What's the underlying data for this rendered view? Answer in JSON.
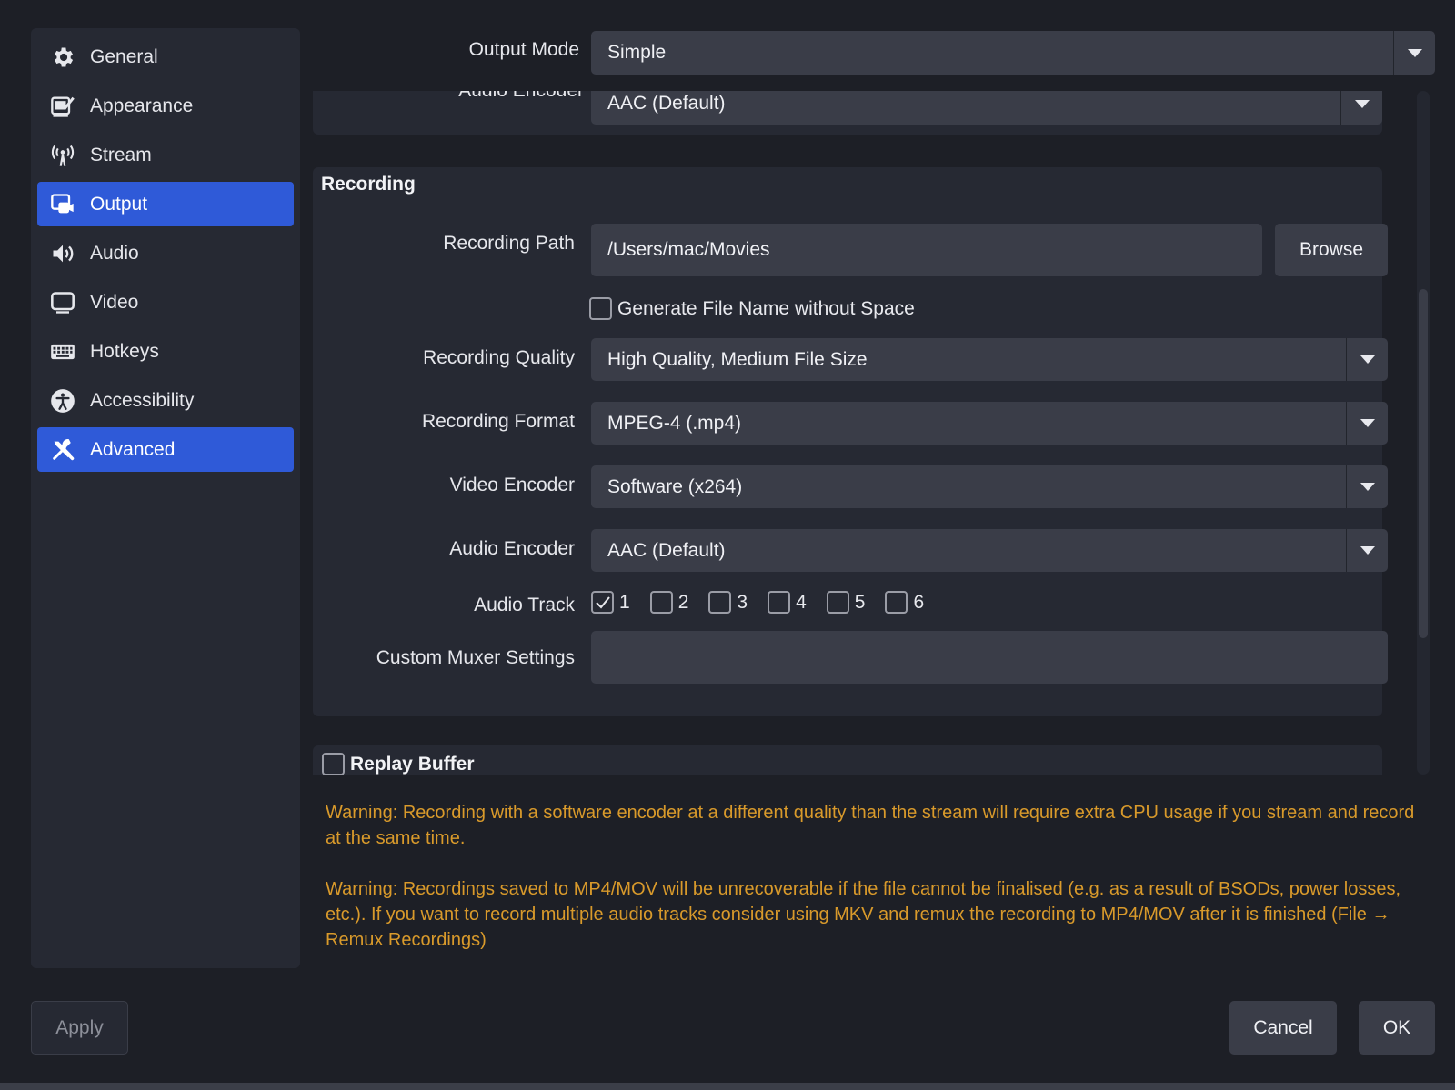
{
  "sidebar": {
    "items": [
      {
        "label": "General",
        "icon": "gear-icon",
        "active": false
      },
      {
        "label": "Appearance",
        "icon": "appearance-icon",
        "active": false
      },
      {
        "label": "Stream",
        "icon": "antenna-icon",
        "active": false
      },
      {
        "label": "Output",
        "icon": "output-icon",
        "active": true
      },
      {
        "label": "Audio",
        "icon": "speaker-icon",
        "active": false
      },
      {
        "label": "Video",
        "icon": "monitor-icon",
        "active": false
      },
      {
        "label": "Hotkeys",
        "icon": "keyboard-icon",
        "active": false
      },
      {
        "label": "Accessibility",
        "icon": "accessibility-icon",
        "active": false
      },
      {
        "label": "Advanced",
        "icon": "tools-icon",
        "active": true
      }
    ]
  },
  "output_mode": {
    "label": "Output Mode",
    "value": "Simple"
  },
  "prev_section": {
    "audio_encoder_label": "Audio Encoder",
    "audio_encoder_value": "AAC (Default)"
  },
  "recording": {
    "title": "Recording",
    "path_label": "Recording Path",
    "path_value": "/Users/mac/Movies",
    "browse_label": "Browse",
    "no_space_label": "Generate File Name without Space",
    "no_space_checked": false,
    "quality_label": "Recording Quality",
    "quality_value": "High Quality, Medium File Size",
    "format_label": "Recording Format",
    "format_value": "MPEG-4 (.mp4)",
    "video_encoder_label": "Video Encoder",
    "video_encoder_value": "Software (x264)",
    "audio_encoder_label": "Audio Encoder",
    "audio_encoder_value": "AAC (Default)",
    "audio_track_label": "Audio Track",
    "tracks": [
      {
        "label": "1",
        "checked": true
      },
      {
        "label": "2",
        "checked": false
      },
      {
        "label": "3",
        "checked": false
      },
      {
        "label": "4",
        "checked": false
      },
      {
        "label": "5",
        "checked": false
      },
      {
        "label": "6",
        "checked": false
      }
    ],
    "muxer_label": "Custom Muxer Settings",
    "muxer_value": ""
  },
  "replay_buffer": {
    "label": "Replay Buffer",
    "checked": false
  },
  "warnings": [
    "Warning: Recording with a software encoder at a different quality than the stream will require extra CPU usage if you stream and record at the same time.",
    "Warning: Recordings saved to MP4/MOV will be unrecoverable if the file cannot be finalised (e.g. as a result of BSODs, power losses, etc.). If you want to record multiple audio tracks consider using MKV and remux the recording to MP4/MOV after it is finished (File → Remux Recordings)"
  ],
  "buttons": {
    "apply": "Apply",
    "cancel": "Cancel",
    "ok": "OK"
  },
  "colors": {
    "accent": "#2f5ad8",
    "warning": "#d99a2b",
    "background": "#1d1f26"
  }
}
